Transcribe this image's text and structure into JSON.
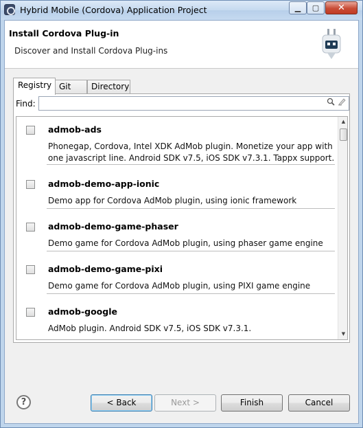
{
  "window": {
    "title": "Hybrid Mobile (Cordova) Application Project"
  },
  "header": {
    "title": "Install Cordova Plug-in",
    "description": "Discover and Install Cordova Plug-ins"
  },
  "tabs": [
    {
      "label": "Registry",
      "active": true
    },
    {
      "label": "Git",
      "active": false
    },
    {
      "label": "Directory",
      "active": false
    }
  ],
  "find": {
    "label": "Find:",
    "value": "",
    "placeholder": ""
  },
  "plugins": [
    {
      "name": "admob-ads",
      "checked": false,
      "description": "Phonegap, Cordova, Intel XDK AdMob plugin. Monetize your app with one javascript line. Android SDK v7.5, iOS SDK v7.3.1. Tappx support."
    },
    {
      "name": "admob-demo-app-ionic",
      "checked": false,
      "description": "Demo app for Cordova AdMob plugin, using ionic framework"
    },
    {
      "name": "admob-demo-game-phaser",
      "checked": false,
      "description": "Demo game for Cordova AdMob plugin, using phaser game engine"
    },
    {
      "name": "admob-demo-game-pixi",
      "checked": false,
      "description": "Demo game for Cordova AdMob plugin, using PIXI game engine"
    },
    {
      "name": "admob-google",
      "checked": false,
      "description": "AdMob plugin. Android SDK v7.5, iOS SDK v7.3.1."
    }
  ],
  "buttons": {
    "help": "?",
    "back": "< Back",
    "next": "Next >",
    "finish": "Finish",
    "cancel": "Cancel"
  },
  "colors": {
    "titlebar": "#c5d9ef",
    "close_button": "#c84c36",
    "background": "#f0f0f0"
  },
  "icons": [
    "cordova-app-icon",
    "cordova-plugin-icon",
    "search-icon",
    "clear-icon",
    "help-icon"
  ]
}
